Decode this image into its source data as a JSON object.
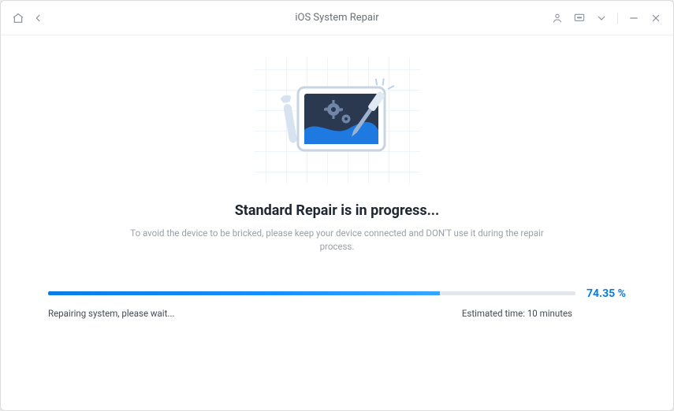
{
  "header": {
    "title": "iOS System Repair"
  },
  "main": {
    "headline": "Standard Repair is in progress...",
    "subnote": "To avoid the device to be bricked, please keep your device connected and DON'T use it during the repair process."
  },
  "progress": {
    "percent_label": "74.35 %",
    "percent_value": 74.35,
    "status_text": "Repairing system, please wait...",
    "estimated_label": "Estimated time: 10 minutes"
  },
  "colors": {
    "accent": "#0a7ce6"
  }
}
